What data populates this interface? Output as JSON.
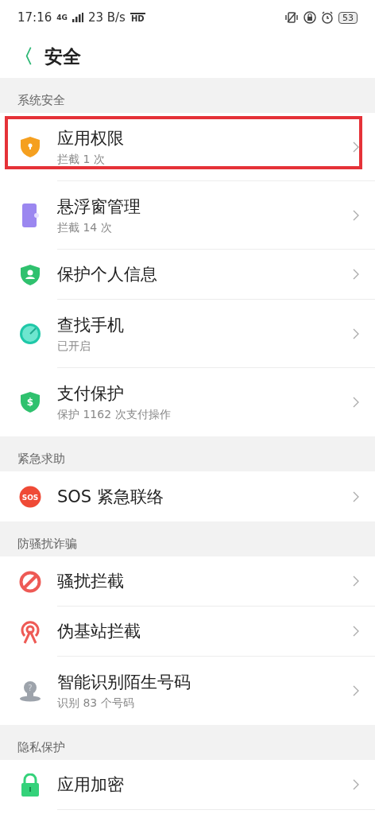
{
  "status_bar": {
    "time": "17:16",
    "network": "4G",
    "speed": "23 B/s",
    "hd": "HD",
    "battery": "53"
  },
  "header": {
    "back": "〈",
    "title": "安全"
  },
  "sections": [
    {
      "title": "系统安全",
      "items": [
        {
          "kind": "shield-lock",
          "title": "应用权限",
          "subtitle": "拦截 1 次",
          "highlighted": true
        },
        {
          "kind": "phone-window",
          "title": "悬浮窗管理",
          "subtitle": "拦截 14 次",
          "highlighted": false
        },
        {
          "kind": "shield-person",
          "title": "保护个人信息",
          "highlighted": false
        },
        {
          "kind": "compass",
          "title": "查找手机",
          "subtitle": "已开启",
          "highlighted": false
        },
        {
          "kind": "shield-dollar",
          "icon_text": "$",
          "title": "支付保护",
          "subtitle": "保护 1162 次支付操作",
          "highlighted": false
        }
      ]
    },
    {
      "title": "紧急求助",
      "items": [
        {
          "kind": "sos",
          "icon_text": "SOS",
          "title": "SOS 紧急联络",
          "highlighted": false
        }
      ]
    },
    {
      "title": "防骚扰诈骗",
      "items": [
        {
          "kind": "block",
          "title": "骚扰拦截",
          "highlighted": false
        },
        {
          "kind": "antenna",
          "title": "伪基站拦截",
          "highlighted": false
        },
        {
          "kind": "person-question",
          "icon_text": "?",
          "title": "智能识别陌生号码",
          "subtitle": "识别 83 个号码",
          "highlighted": false
        }
      ]
    },
    {
      "title": "隐私保护",
      "items": [
        {
          "kind": "lock",
          "title": "应用加密",
          "highlighted": false
        }
      ]
    }
  ]
}
